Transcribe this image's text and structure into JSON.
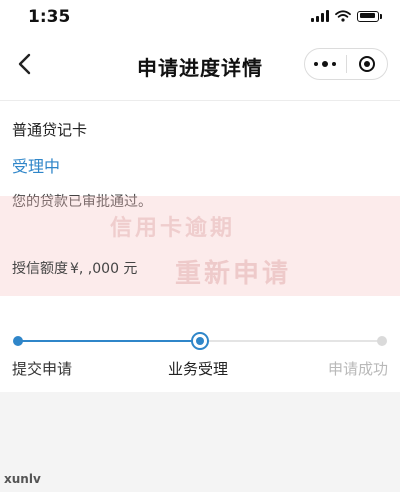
{
  "status_bar": {
    "time": "1:35"
  },
  "nav": {
    "title": "申请进度详情"
  },
  "card": {
    "name": "普通贷记卡",
    "status": "受理中",
    "approval_msg": "您的贷款已审批通过。",
    "credit_label": "授信额度",
    "credit_value": "¥,  ,000 元"
  },
  "watermark": {
    "line1": "信用卡逾期",
    "line2": "重新申请"
  },
  "progress": {
    "current_step": 2,
    "steps": [
      {
        "label": "提交申请",
        "state": "done"
      },
      {
        "label": "业务受理",
        "state": "current"
      },
      {
        "label": "申请成功",
        "state": "pending"
      }
    ]
  },
  "footer": {
    "source_mark": "xunlv"
  },
  "colors": {
    "accent": "#2f86c9",
    "pending": "#dadada",
    "watermark_band": "#f5c3c3",
    "background": "#ffffff",
    "bottom_area": "#f4f4f4"
  }
}
